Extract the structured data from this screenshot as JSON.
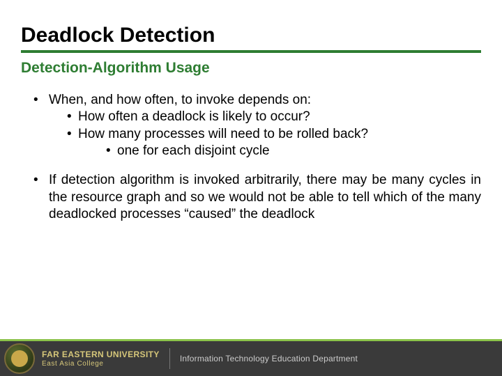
{
  "slide": {
    "title": "Deadlock Detection",
    "subtitle": "Detection-Algorithm Usage",
    "bullets": {
      "p1": "When, and how often, to invoke depends on:",
      "p1a": "How often a deadlock is likely to occur?",
      "p1b": "How many processes will need to be rolled back?",
      "p1b1": "one for each disjoint cycle",
      "p2": "If detection algorithm is invoked arbitrarily, there may be many cycles in the resource graph and so we would not be able to tell which of the many deadlocked processes “caused” the deadlock"
    }
  },
  "footer": {
    "university": "FAR EASTERN UNIVERSITY",
    "college": "East Asia College",
    "department": "Information Technology Education Department"
  },
  "colors": {
    "accent": "#2e7d32",
    "footer_bg": "#3a3a3a"
  }
}
